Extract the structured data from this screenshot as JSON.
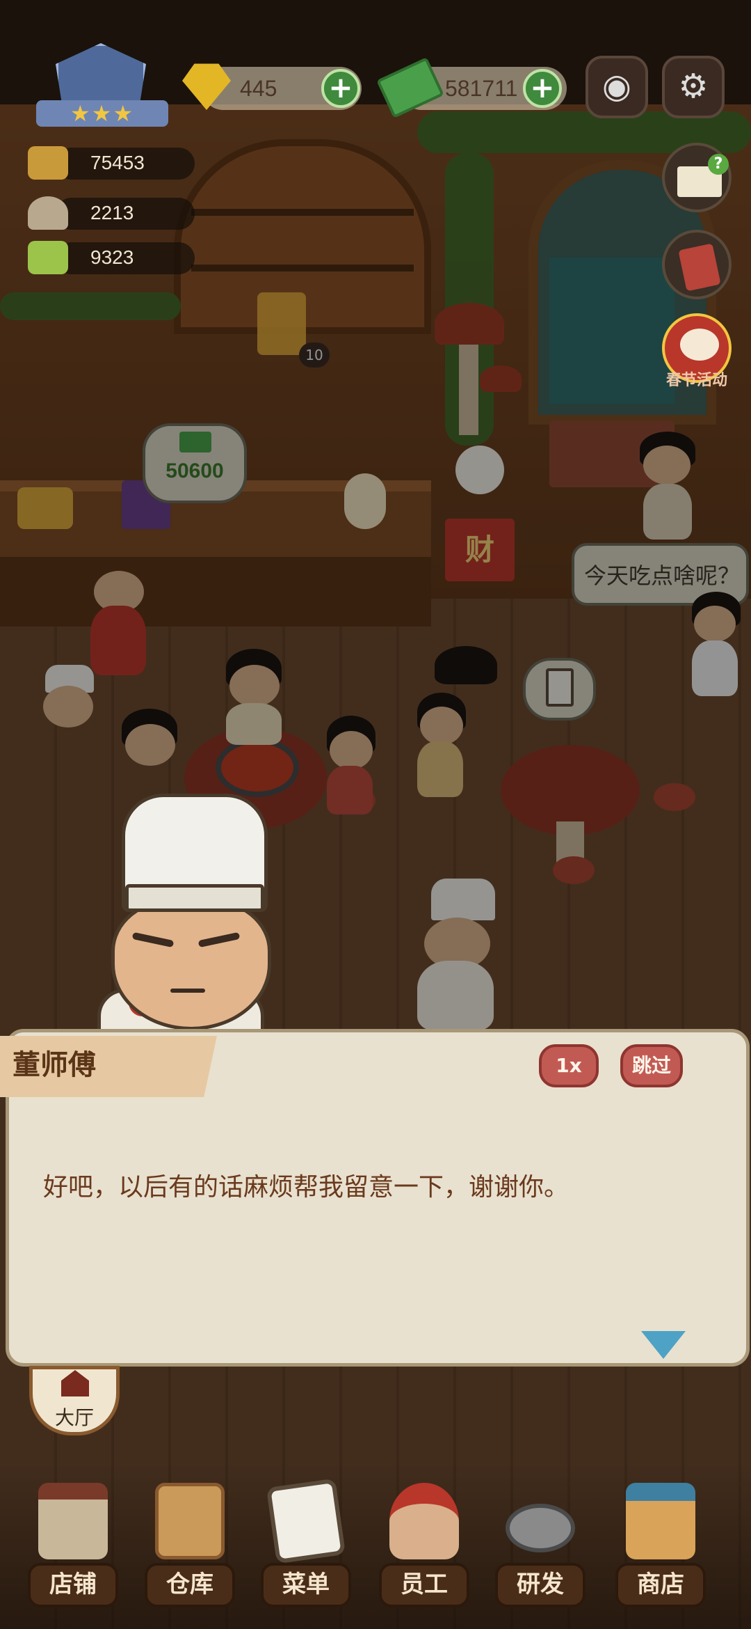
{
  "hud": {
    "gems": "445",
    "cash": "581711",
    "stats": [
      {
        "icon": "food-tray-icon",
        "value": "75453"
      },
      {
        "icon": "cloche-icon",
        "value": "2213"
      },
      {
        "icon": "ticket-icon",
        "value": "9323"
      }
    ]
  },
  "side_menu": {
    "help_icon": "recipe-book-help-icon",
    "notes_icon": "red-notebook-icon",
    "event_label": "春节活动"
  },
  "scene": {
    "bill_amount": "50600",
    "juice_count": "10",
    "customer_speech": "今天吃点啥呢？",
    "fortune_sign": "财"
  },
  "dialog": {
    "speaker": "董师傅",
    "speed_label": "1x",
    "skip_label": "跳过",
    "text": "好吧，以后有的话麻烦帮我留意一下，谢谢你。"
  },
  "hall_label": "大厅",
  "nav": [
    {
      "label": "店铺",
      "icon": "shop-front-icon"
    },
    {
      "label": "仓库",
      "icon": "boxes-icon"
    },
    {
      "label": "菜单",
      "icon": "menu-clipboard-icon"
    },
    {
      "label": "员工",
      "icon": "staff-icon"
    },
    {
      "label": "研发",
      "icon": "wok-icon"
    },
    {
      "label": "商店",
      "icon": "store-icon"
    }
  ],
  "colors": {
    "dialog_bg": "#e9e1cf",
    "button_red": "#c25a54",
    "plus_green": "#3f8a3d",
    "nav_label_bg": "#4a2d18"
  }
}
